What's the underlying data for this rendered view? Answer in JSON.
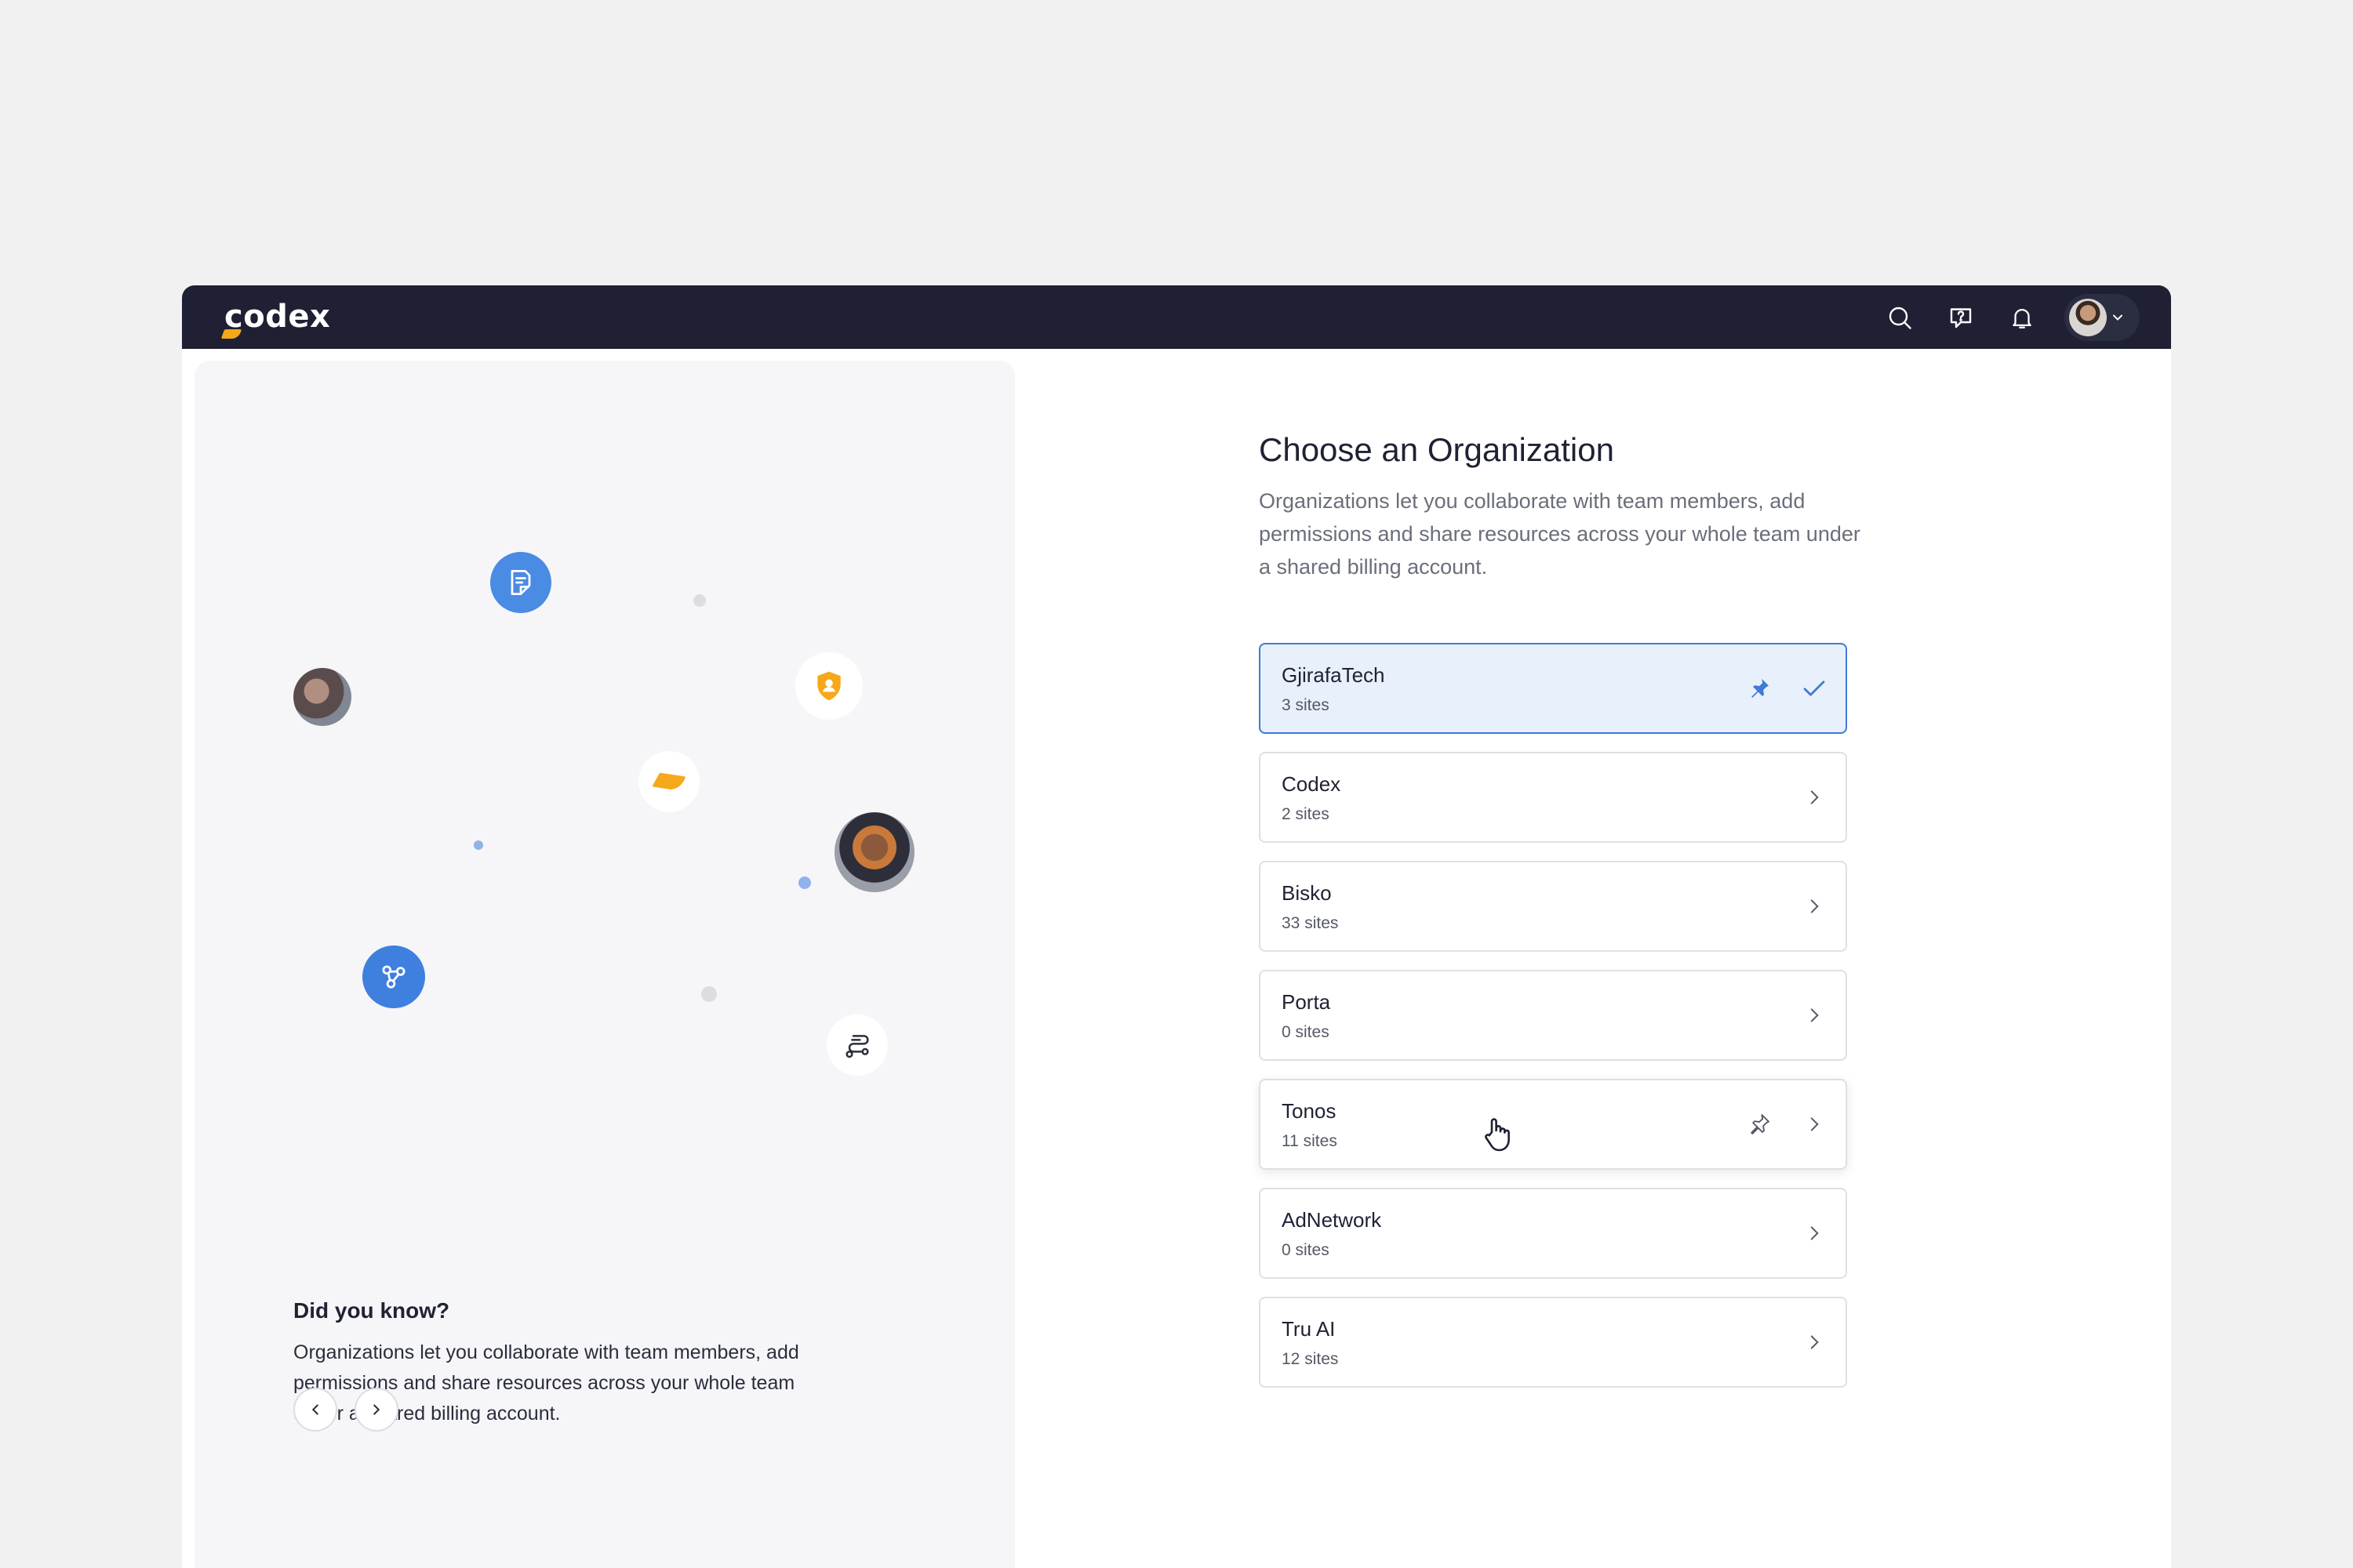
{
  "app": {
    "logo_text": "codex",
    "brand_accent": "#f6a81b",
    "topbar_color": "#1f2033"
  },
  "topbar": {
    "icons": [
      "search-icon",
      "help-chat-icon",
      "bell-icon",
      "user-avatar",
      "chevron-down-icon"
    ]
  },
  "left_panel": {
    "title": "Did you know?",
    "text": "Organizations let you collaborate with team members, add permissions and share resources across your whole team under a shared billing account.",
    "prev_icon": "chevron-left-icon",
    "next_icon": "chevron-right-icon"
  },
  "main": {
    "title": "Choose an Organization",
    "description": "Organizations let you collaborate with team members, add permissions and share resources across your whole team under a shared billing account.",
    "selected_color": "#3e7ad6",
    "organizations": [
      {
        "name": "GjirafaTech",
        "sites": "3 sites",
        "selected": true,
        "pinned": true
      },
      {
        "name": "Codex",
        "sites": "2 sites"
      },
      {
        "name": "Bisko",
        "sites": "33 sites"
      },
      {
        "name": "Porta",
        "sites": "0 sites"
      },
      {
        "name": "Tonos",
        "sites": "11 sites",
        "hovered": true
      },
      {
        "name": "AdNetwork",
        "sites": "0 sites"
      },
      {
        "name": "Tru AI",
        "sites": "12 sites"
      }
    ]
  }
}
